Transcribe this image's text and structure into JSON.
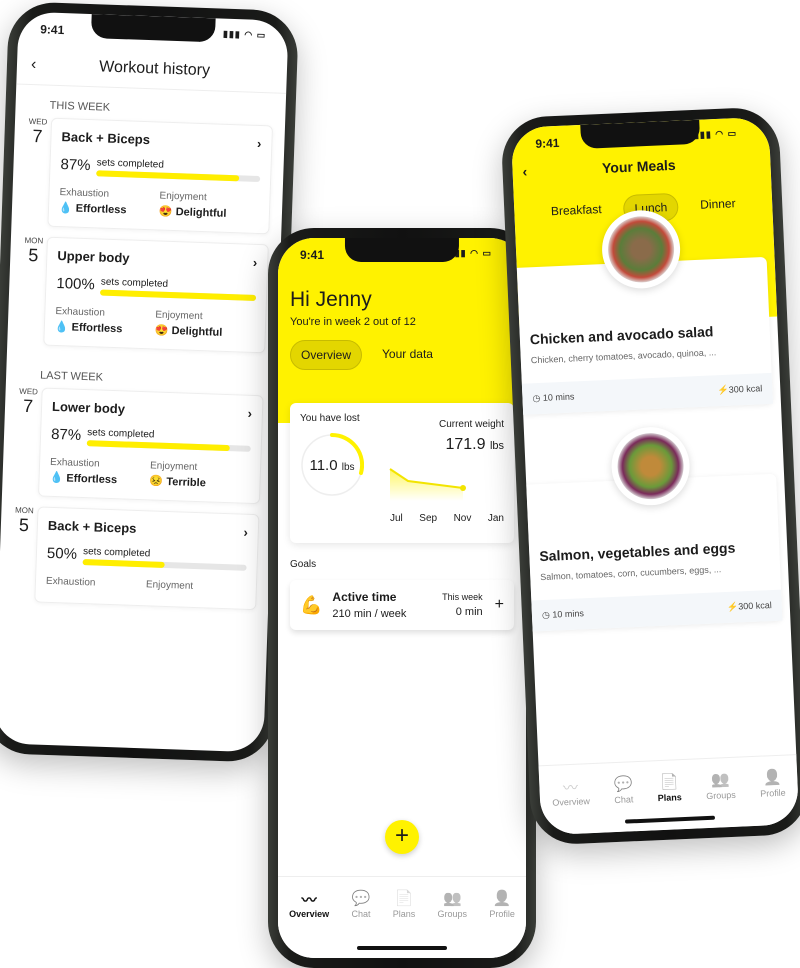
{
  "time": "9:41",
  "workout": {
    "title": "Workout history",
    "sections": [
      {
        "label": "THIS WEEK",
        "items": [
          {
            "dow": "WED",
            "day": "7",
            "name": "Back + Biceps",
            "pct": "87%",
            "progress": 87,
            "sets_label": "sets completed",
            "exh_label": "Exhaustion",
            "exh": "Effortless",
            "enj_label": "Enjoyment",
            "enj": "Delightful"
          },
          {
            "dow": "MON",
            "day": "5",
            "name": "Upper body",
            "pct": "100%",
            "progress": 100,
            "sets_label": "sets completed",
            "exh_label": "Exhaustion",
            "exh": "Effortless",
            "enj_label": "Enjoyment",
            "enj": "Delightful"
          }
        ]
      },
      {
        "label": "LAST WEEK",
        "items": [
          {
            "dow": "WED",
            "day": "7",
            "name": "Lower body",
            "pct": "87%",
            "progress": 87,
            "sets_label": "sets completed",
            "exh_label": "Exhaustion",
            "exh": "Effortless",
            "enj_label": "Enjoyment",
            "enj": "Terrible"
          },
          {
            "dow": "MON",
            "day": "5",
            "name": "Back + Biceps",
            "pct": "50%",
            "progress": 50,
            "sets_label": "sets completed",
            "exh_label": "Exhaustion",
            "exh": "",
            "enj_label": "Enjoyment",
            "enj": ""
          }
        ]
      }
    ]
  },
  "overview": {
    "greeting": "Hi Jenny",
    "week": "You're in week 2 out of 12",
    "tabs": [
      "Overview",
      "Your data"
    ],
    "lost_label": "You have lost",
    "lost_value": "11.0",
    "lost_unit": "lbs",
    "current_label": "Current weight",
    "current_value": "171.9",
    "current_unit": "lbs",
    "months": [
      "Jul",
      "Sep",
      "Nov",
      "Jan"
    ],
    "goals_label": "Goals",
    "goal": {
      "name": "Active time",
      "target": "210 min / week",
      "week_label": "This week",
      "week_value": "0 min",
      "add": "+"
    },
    "fab": "+"
  },
  "meals": {
    "title": "Your Meals",
    "tabs": [
      "Breakfast",
      "Lunch",
      "Dinner"
    ],
    "items": [
      {
        "name": "Chicken and avocado salad",
        "desc": "Chicken, cherry tomatoes, avocado, quinoa, ...",
        "time": "10 mins",
        "kcal": "300 kcal"
      },
      {
        "name": "Salmon, vegetables and eggs",
        "desc": "Salmon, tomatoes, corn, cucumbers, eggs, ...",
        "time": "10 mins",
        "kcal": "300 kcal"
      }
    ]
  },
  "tabbar": [
    "Overview",
    "Chat",
    "Plans",
    "Groups",
    "Profile"
  ],
  "colors": {
    "accent": "#fff200"
  }
}
